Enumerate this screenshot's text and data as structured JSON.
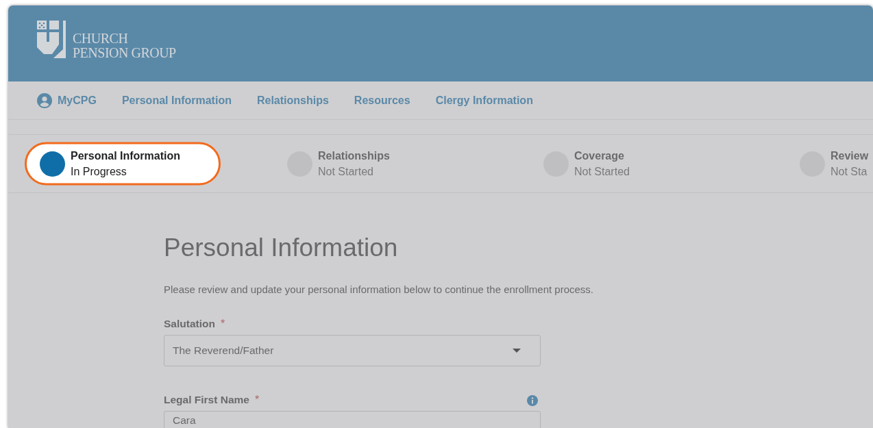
{
  "header": {
    "logo_lines": [
      "CHURCH",
      "PENSION GROUP"
    ]
  },
  "nav": [
    {
      "label": "MyCPG",
      "kind": "account"
    },
    {
      "label": "Personal Information",
      "kind": "link"
    },
    {
      "label": "Relationships",
      "kind": "link"
    },
    {
      "label": "Resources",
      "kind": "link"
    },
    {
      "label": "Clergy Information",
      "kind": "link"
    }
  ],
  "steps": [
    {
      "title": "Personal Information",
      "status": "In Progress",
      "selected": true
    },
    {
      "title": "Relationships",
      "status": "Not Started",
      "selected": false
    },
    {
      "title": "Coverage",
      "status": "Not Started",
      "selected": false
    },
    {
      "title": "Review",
      "status": "Not Sta",
      "selected": false
    }
  ],
  "page": {
    "title": "Personal Information",
    "intro": "Please review and update your personal information below to continue the enrollment process."
  },
  "fields": [
    {
      "label": "Salutation",
      "required": true,
      "required_mark": "*",
      "kind": "select",
      "value": "The Reverend/Father",
      "info": false
    },
    {
      "label": "Legal First Name",
      "required": true,
      "required_mark": "*",
      "kind": "text",
      "value": "Cara",
      "info": true
    }
  ]
}
